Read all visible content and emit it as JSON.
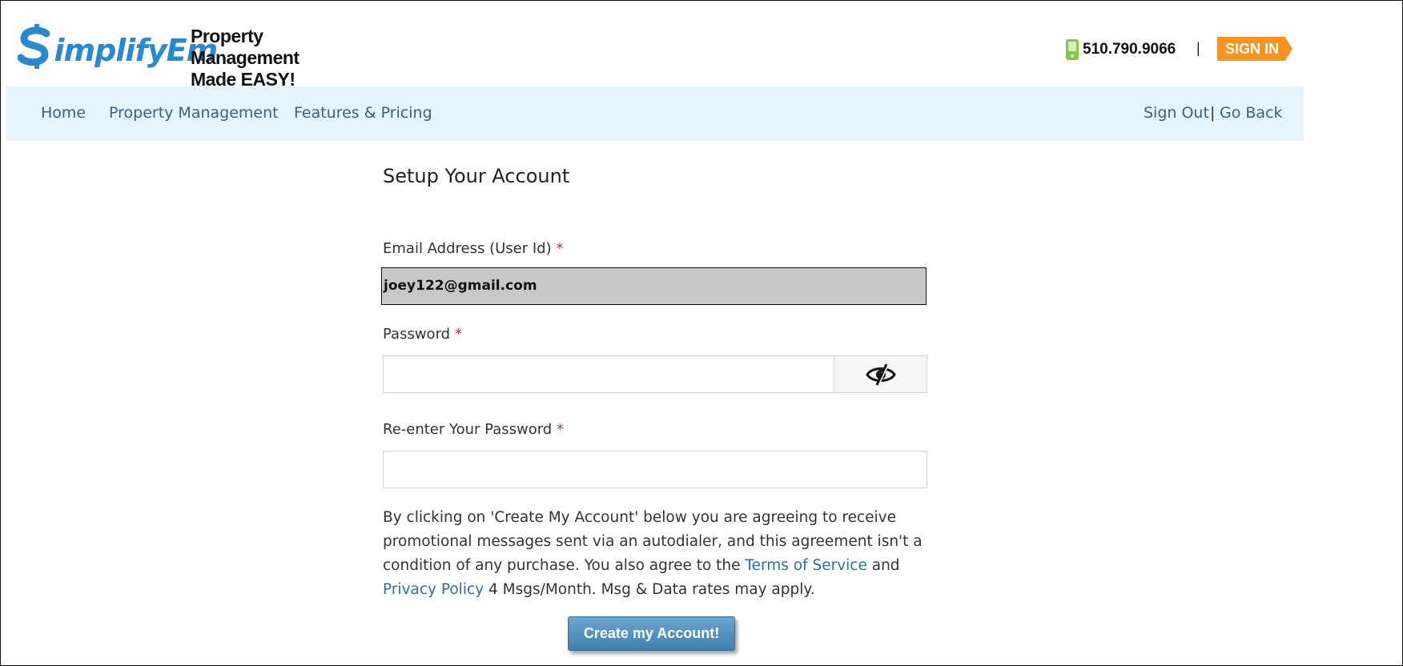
{
  "header": {
    "logo_text_part1": "$implify",
    "logo_text_part2": "Em",
    "tagline_line1": "Property Management",
    "tagline_line2": "Made EASY!",
    "phone": "510.790.9066",
    "separator": "|",
    "sign_in": "SIGN IN"
  },
  "nav": {
    "items": [
      "Home",
      "Property Management",
      "Features & Pricing"
    ],
    "sign_out": "Sign Out",
    "divider": "|",
    "go_back": "Go Back"
  },
  "form": {
    "title": "Setup Your Account",
    "email_label": "Email Address (User Id)",
    "required_mark": "*",
    "email_value": "joey122@gmail.com",
    "password_label": "Password",
    "password_value": "",
    "reenter_label": "Re-enter Your Password",
    "reenter_value": "",
    "terms_part1": "By clicking on 'Create My Account' below you are agreeing to receive promotional messages sent via an autodialer, and this agreement isn't a condition of any purchase. You also agree to the ",
    "terms_link1": "Terms of Service",
    "terms_and": " and ",
    "terms_link2": "Privacy Policy",
    "terms_part2": " 4 Msgs/Month. Msg & Data rates may apply.",
    "submit": "Create my Account!"
  },
  "colors": {
    "brand_blue": "#2a8ad0",
    "sign_in_orange": "#f7931e",
    "nav_bg": "#e6f5fd",
    "link": "#2f6ea3"
  },
  "icons": {
    "phone": "phone-icon",
    "password_toggle": "eye-slash-icon",
    "logo": "dollar-sign-icon"
  }
}
